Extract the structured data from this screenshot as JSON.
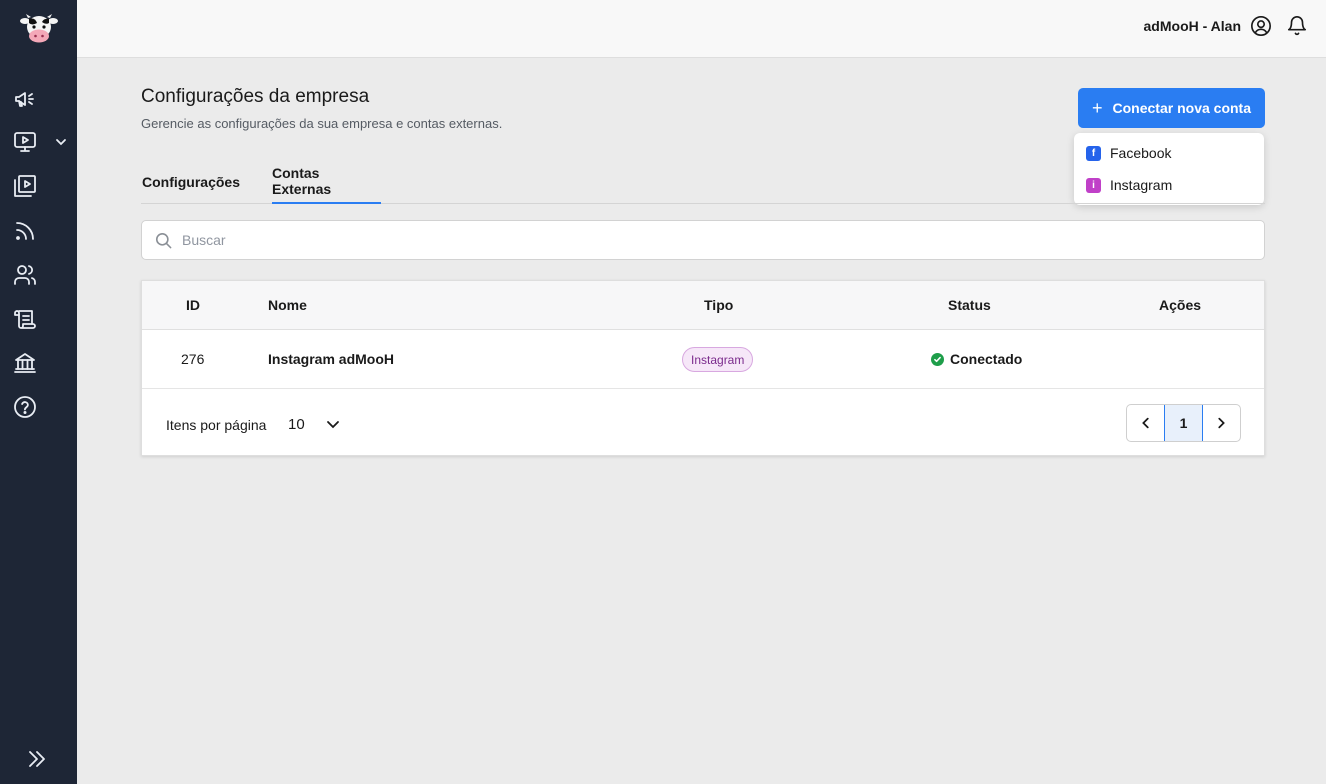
{
  "header": {
    "user_label": "adMooH - Alan"
  },
  "sidebar": {
    "logo_icon": "cow-icon",
    "items": [
      {
        "icon": "megaphone-icon"
      },
      {
        "icon": "monitor-play-icon"
      },
      {
        "icon": "media-library-icon"
      },
      {
        "icon": "rss-feed-icon"
      },
      {
        "icon": "users-icon"
      },
      {
        "icon": "scroll-icon"
      },
      {
        "icon": "bank-icon"
      },
      {
        "icon": "help-icon"
      }
    ]
  },
  "page": {
    "title": "Configurações da empresa",
    "subtitle": "Gerencie as configurações da sua empresa e contas externas."
  },
  "connect_button": {
    "label": "Conectar nova conta",
    "menu": [
      {
        "label": "Facebook",
        "badge": "f",
        "color": "#2563eb"
      },
      {
        "label": "Instagram",
        "badge": "i",
        "color": "#c040c8"
      }
    ]
  },
  "tabs": [
    {
      "label": "Configurações",
      "active": false
    },
    {
      "label": "Contas Externas",
      "active": true
    }
  ],
  "search": {
    "placeholder": "Buscar",
    "value": ""
  },
  "table": {
    "columns": [
      "ID",
      "Nome",
      "Tipo",
      "Status",
      "Ações"
    ],
    "rows": [
      {
        "id": "276",
        "name": "Instagram adMooH",
        "type": "Instagram",
        "status": "Conectado"
      }
    ]
  },
  "pagination": {
    "items_per_page_label": "Itens por página",
    "items_per_page": "10",
    "current_page": "1"
  },
  "colors": {
    "accent": "#2a7df2",
    "sidebar": "#1e2636",
    "status_ok": "#1e9e4a"
  }
}
